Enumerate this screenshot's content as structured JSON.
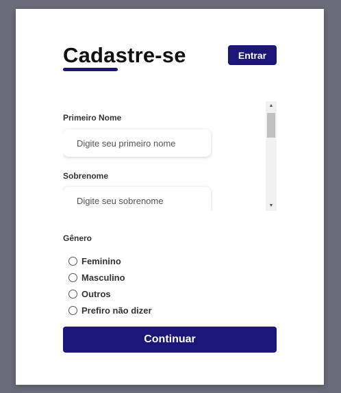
{
  "header": {
    "title": "Cadastre-se",
    "login_button": "Entrar"
  },
  "form": {
    "first_name": {
      "label": "Primeiro Nome",
      "placeholder": "Digite seu primeiro nome",
      "value": ""
    },
    "last_name": {
      "label": "Sobrenome",
      "placeholder": "Digite seu sobrenome",
      "value": ""
    },
    "gender": {
      "label": "Gênero",
      "options": [
        "Feminino",
        "Masculino",
        "Outros",
        "Prefiro não dizer"
      ],
      "selected": null
    },
    "submit_label": "Continuar"
  },
  "colors": {
    "accent": "#1c1678",
    "background": "#6b6b7b",
    "card": "#ffffff"
  }
}
